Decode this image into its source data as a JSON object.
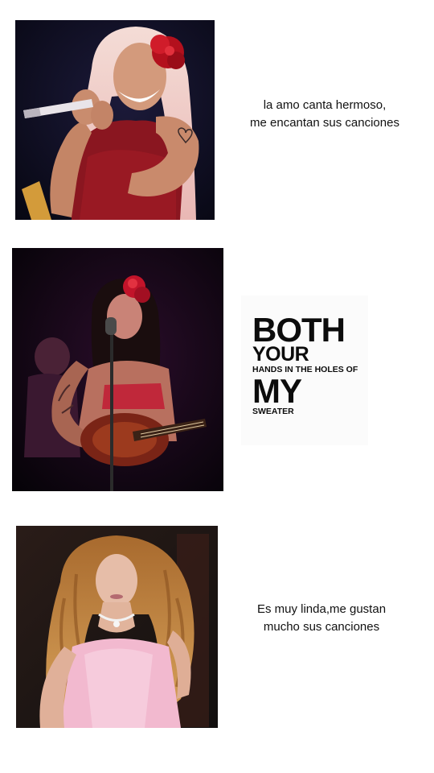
{
  "photos": [
    {
      "alt": "singer with pink hair and red flower holding a microphone"
    },
    {
      "alt": "singer with dark hair and red flower playing guitar at a microphone"
    },
    {
      "alt": "singer with long curly blonde hair in a pink dress"
    }
  ],
  "captions": {
    "first": {
      "line1": "la amo canta hermoso,",
      "line2": "me encantan sus canciones"
    },
    "third": {
      "line1": "Es muy linda,me gustan",
      "line2": "mucho sus canciones"
    }
  },
  "lyric_card": {
    "line1": "BOTH",
    "line2": "YOUR",
    "line3": "HANDS IN THE HOLES OF",
    "line4": "MY",
    "line5": "SWEATER"
  }
}
